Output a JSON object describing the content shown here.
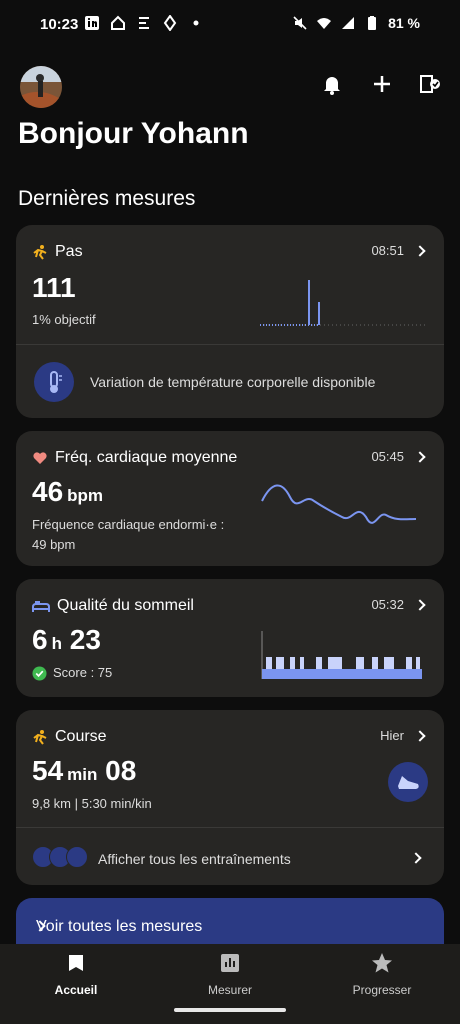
{
  "status": {
    "time": "10:23",
    "battery": "81 %"
  },
  "header": {
    "greeting": "Bonjour Yohann",
    "section_title": "Dernières mesures"
  },
  "steps": {
    "title": "Pas",
    "time": "08:51",
    "value": "111",
    "goal": "1% objectif",
    "notice": "Variation de température corporelle disponible"
  },
  "heart": {
    "title": "Fréq. cardiaque moyenne",
    "time": "05:45",
    "value": "46",
    "unit": "bpm",
    "sub_line1": "Fréquence cardiaque endormi·e :",
    "sub_line2": "49 bpm"
  },
  "sleep": {
    "title": "Qualité du sommeil",
    "time": "05:32",
    "hours": "6",
    "h_unit": "h",
    "minutes": "23",
    "score": "Score : 75"
  },
  "run": {
    "title": "Course",
    "time": "Hier",
    "min": "54",
    "min_unit": "min",
    "sec": "08",
    "stats": "9,8 km | 5:30 min/kin",
    "all_workouts": "Afficher tous les entraînements"
  },
  "cta": {
    "label": "Voir toutes les mesures"
  },
  "nav": {
    "home": "Accueil",
    "measure": "Mesurer",
    "progress": "Progresser"
  },
  "colors": {
    "accent": "#7b95f0",
    "card": "#272624",
    "cta": "#2b3a84",
    "heart": "#f08a80",
    "run": "#f2b01e",
    "success": "#3fb950"
  }
}
